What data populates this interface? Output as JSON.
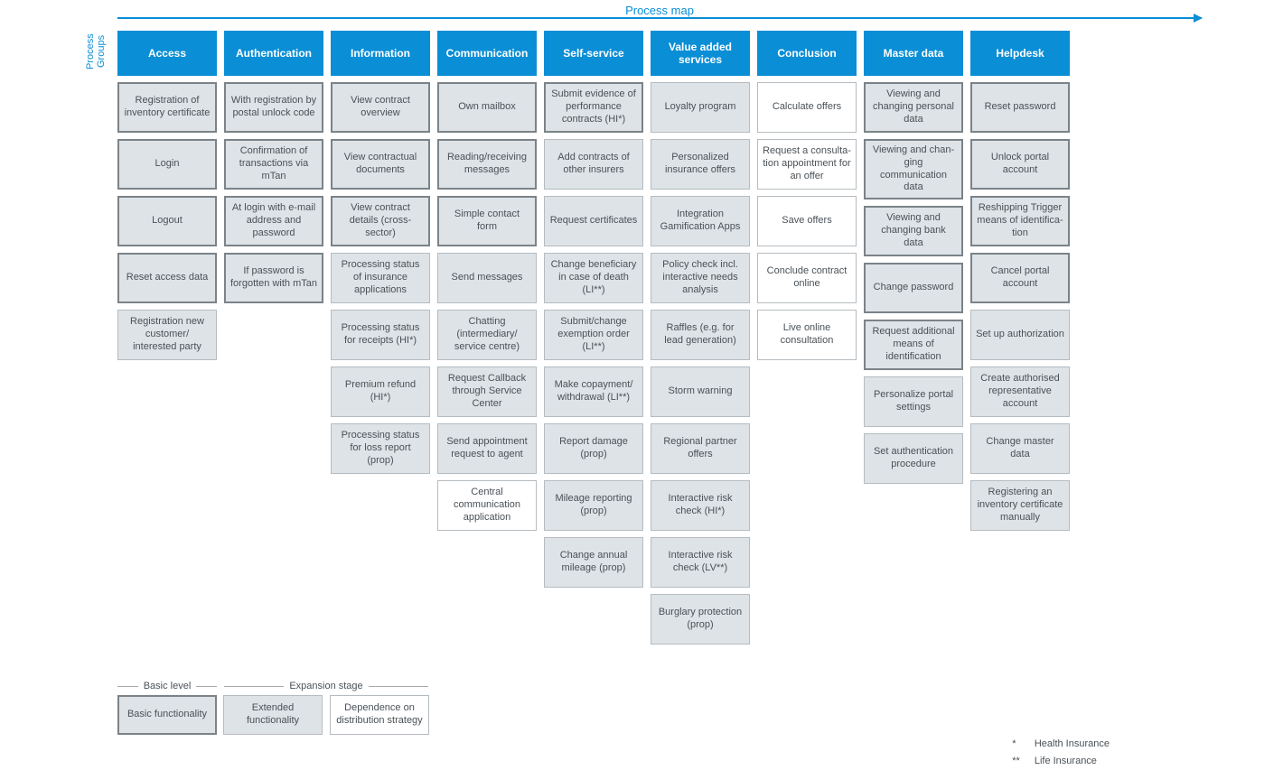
{
  "title": "Process map",
  "side_label": "Process\nGroups",
  "columns": [
    {
      "header": "Access",
      "cells": [
        {
          "t": "Registration of inventory certificate",
          "c": "basic"
        },
        {
          "t": "Login",
          "c": "basic"
        },
        {
          "t": "Logout",
          "c": "basic"
        },
        {
          "t": "Reset access data",
          "c": "basic"
        },
        {
          "t": "Registration new customer/ interested party",
          "c": "ext"
        }
      ]
    },
    {
      "header": "Authentication",
      "cells": [
        {
          "t": "With registration by postal unlock code",
          "c": "basic"
        },
        {
          "t": "Confirmation of transactions via mTan",
          "c": "basic"
        },
        {
          "t": "At login with e-mail address and password",
          "c": "basic"
        },
        {
          "t": "If password is forgotten with mTan",
          "c": "basic"
        }
      ]
    },
    {
      "header": "Information",
      "cells": [
        {
          "t": "View contract overview",
          "c": "basic"
        },
        {
          "t": "View contractual documents",
          "c": "basic"
        },
        {
          "t": "View contract details (cross-sector)",
          "c": "basic"
        },
        {
          "t": "Processing status of insurance applications",
          "c": "ext"
        },
        {
          "t": "Processing status for receipts (HI*)",
          "c": "ext"
        },
        {
          "t": "Premium refund (HI*)",
          "c": "ext"
        },
        {
          "t": "Processing status for loss report (prop)",
          "c": "ext"
        }
      ]
    },
    {
      "header": "Communication",
      "cells": [
        {
          "t": "Own mailbox",
          "c": "basic"
        },
        {
          "t": "Reading/receiving messages",
          "c": "basic"
        },
        {
          "t": "Simple contact form",
          "c": "basic"
        },
        {
          "t": "Send messages",
          "c": "ext"
        },
        {
          "t": "Chatting (intermediary/ service centre)",
          "c": "ext"
        },
        {
          "t": "Request Callback through Service Center",
          "c": "ext"
        },
        {
          "t": "Send appointment request to agent",
          "c": "ext"
        },
        {
          "t": "Central communication application",
          "c": "dist"
        }
      ]
    },
    {
      "header": "Self-service",
      "cells": [
        {
          "t": "Submit evidence of performance contracts (HI*)",
          "c": "basic"
        },
        {
          "t": "Add contracts of other insurers",
          "c": "ext"
        },
        {
          "t": "Request certificates",
          "c": "ext"
        },
        {
          "t": "Change beneficiary in case of death (LI**)",
          "c": "ext"
        },
        {
          "t": "Submit/change exemption order (LI**)",
          "c": "ext"
        },
        {
          "t": "Make copayment/ withdrawal (LI**)",
          "c": "ext"
        },
        {
          "t": "Report damage (prop)",
          "c": "ext"
        },
        {
          "t": "Mileage reporting (prop)",
          "c": "ext"
        },
        {
          "t": "Change annual mileage (prop)",
          "c": "ext"
        }
      ]
    },
    {
      "header": "Value added services",
      "cells": [
        {
          "t": "Loyalty program",
          "c": "ext"
        },
        {
          "t": "Personalized insurance offers",
          "c": "ext"
        },
        {
          "t": "Integration Gamification Apps",
          "c": "ext"
        },
        {
          "t": "Policy check incl. interactive needs analysis",
          "c": "ext"
        },
        {
          "t": "Raffles (e.g. for lead generation)",
          "c": "ext"
        },
        {
          "t": "Storm warning",
          "c": "ext"
        },
        {
          "t": "Regional partner offers",
          "c": "ext"
        },
        {
          "t": "Interactive risk check (HI*)",
          "c": "ext"
        },
        {
          "t": "Interactive risk check (LV**)",
          "c": "ext"
        },
        {
          "t": "Burglary protection (prop)",
          "c": "ext"
        }
      ]
    },
    {
      "header": "Conclusion",
      "cells": [
        {
          "t": "Calculate offers",
          "c": "dist"
        },
        {
          "t": "Request a consulta- tion appointment for an offer",
          "c": "dist"
        },
        {
          "t": "Save offers",
          "c": "dist"
        },
        {
          "t": "Conclude contract online",
          "c": "dist"
        },
        {
          "t": "Live online consultation",
          "c": "dist"
        }
      ]
    },
    {
      "header": "Master data",
      "cells": [
        {
          "t": "Viewing and changing personal data",
          "c": "basic"
        },
        {
          "t": "Viewing and chan- ging communication data",
          "c": "basic"
        },
        {
          "t": "Viewing and changing bank data",
          "c": "basic"
        },
        {
          "t": "Change password",
          "c": "basic"
        },
        {
          "t": "Request additional means of identification",
          "c": "basic"
        },
        {
          "t": "Personalize portal settings",
          "c": "ext"
        },
        {
          "t": "Set authentication procedure",
          "c": "ext"
        }
      ]
    },
    {
      "header": "Helpdesk",
      "cells": [
        {
          "t": "Reset password",
          "c": "basic"
        },
        {
          "t": "Unlock portal account",
          "c": "basic"
        },
        {
          "t": "Reshipping Trigger means of identifica- tion",
          "c": "basic"
        },
        {
          "t": "Cancel portal account",
          "c": "basic"
        },
        {
          "t": "Set up authorization",
          "c": "ext"
        },
        {
          "t": "Create authorised representative account",
          "c": "ext"
        },
        {
          "t": "Change master data",
          "c": "ext"
        },
        {
          "t": "Registering an inventory certificate manually",
          "c": "ext"
        }
      ]
    }
  ],
  "legend": {
    "basic_title": "Basic level",
    "expansion_title": "Expansion stage",
    "basic": "Basic functionality",
    "ext": "Extended functionality",
    "dist": "Dependence on distribution strategy"
  },
  "footnotes": [
    {
      "mark": "*",
      "text": "Health Insurance"
    },
    {
      "mark": "**",
      "text": "Life Insurance"
    }
  ]
}
